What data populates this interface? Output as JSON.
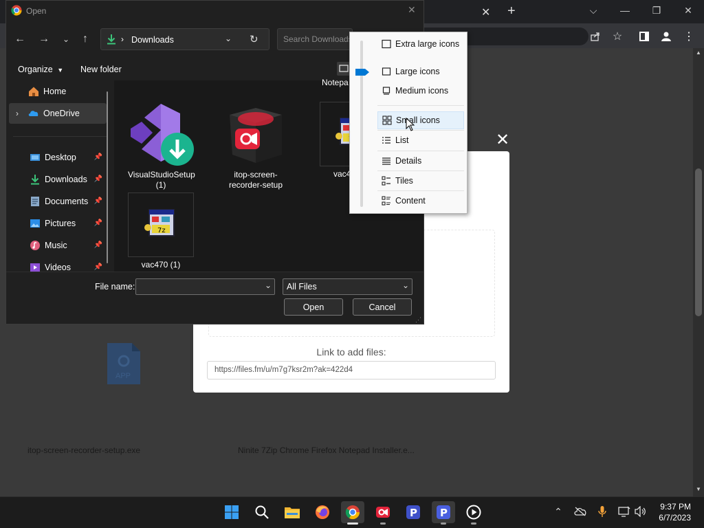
{
  "dialog": {
    "title": "Open",
    "address": "Downloads",
    "search_placeholder": "Search Downloads",
    "organize_label": "Organize",
    "new_folder_label": "New folder",
    "file_name_label": "File name:",
    "file_name_value": "",
    "file_type_selected": "All Files",
    "open_label": "Open",
    "cancel_label": "Cancel",
    "partial_label_1": "Notepa",
    "nav_items": [
      {
        "label": "Home",
        "icon": "home-icon"
      },
      {
        "label": "OneDrive",
        "icon": "onedrive-cloud-icon"
      },
      {
        "label": "Desktop",
        "icon": "desktop-folder-icon"
      },
      {
        "label": "Downloads",
        "icon": "download-arrow-icon"
      },
      {
        "label": "Documents",
        "icon": "documents-folder-icon"
      },
      {
        "label": "Pictures",
        "icon": "pictures-folder-icon"
      },
      {
        "label": "Music",
        "icon": "music-icon"
      },
      {
        "label": "Videos",
        "icon": "videos-icon"
      }
    ],
    "files": [
      {
        "label": "VisualStudioSetup (1)",
        "icon": "visual-studio-installer-icon"
      },
      {
        "label": "itop-screen-recorder-setup",
        "icon": "itop-recorder-box-icon"
      },
      {
        "label": "vac4",
        "icon": "vac-installer-icon"
      },
      {
        "label": "vac470 (1)",
        "icon": "vac-installer-icon"
      }
    ]
  },
  "view_menu": {
    "items": [
      {
        "label": "Extra large icons",
        "icon": "extra-large-icons-icon"
      },
      {
        "label": "Large icons",
        "icon": "large-icons-icon"
      },
      {
        "label": "Medium icons",
        "icon": "medium-icons-icon"
      },
      {
        "label": "Small icons",
        "icon": "small-icons-icon",
        "highlighted": true
      },
      {
        "label": "List",
        "icon": "list-view-icon"
      },
      {
        "label": "Details",
        "icon": "details-view-icon"
      },
      {
        "label": "Tiles",
        "icon": "tiles-view-icon"
      },
      {
        "label": "Content",
        "icon": "content-view-icon"
      }
    ]
  },
  "page": {
    "link_label": "Link to add files:",
    "link_value": "https://files.fm/u/m7g7ksr2m?ak=422d4",
    "bg_file_1": "itop-screen-recorder-setup.exe",
    "bg_file_2": "Ninite 7Zip Chrome Firefox Notepad Installer.e...",
    "bg_file_icon_label": "APP"
  },
  "taskbar": {
    "time": "9:37 PM",
    "date": "6/7/2023"
  },
  "colors": {
    "accent": "#0078d4",
    "dialog_bg": "#202020",
    "menu_bg": "#f9f9f9"
  }
}
